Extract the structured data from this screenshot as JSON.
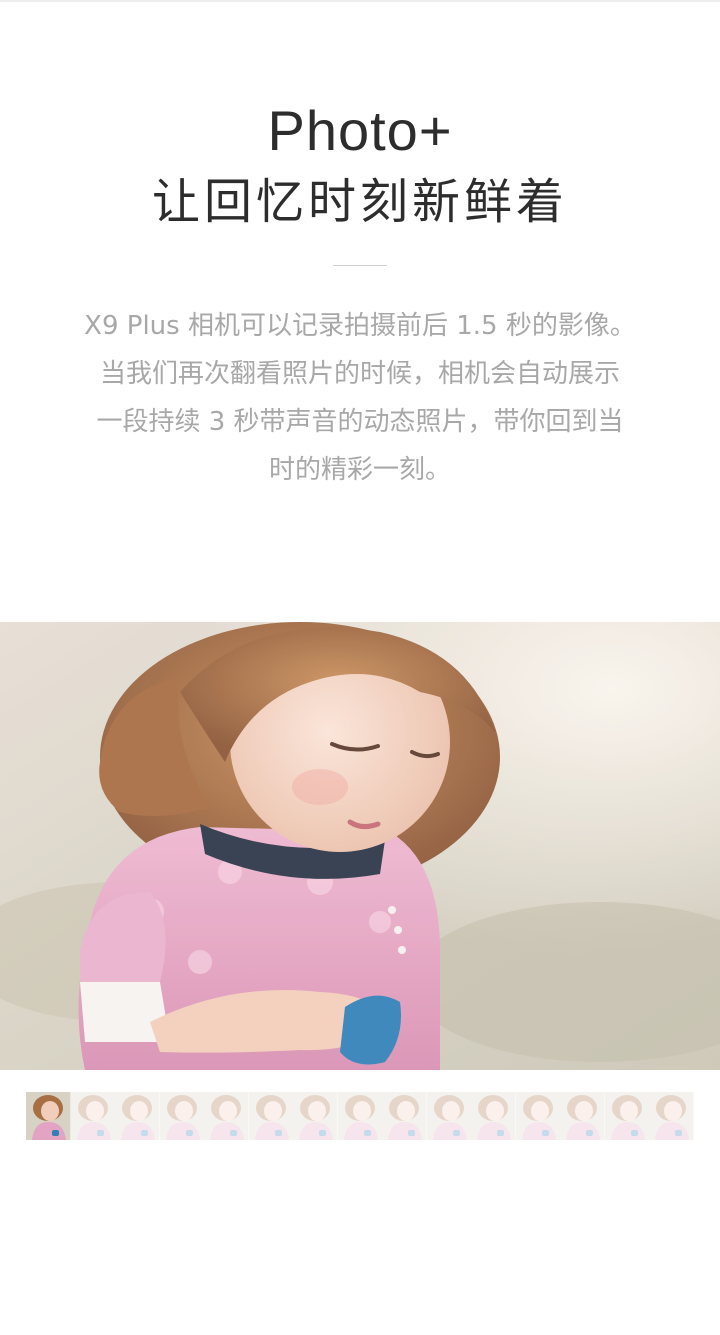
{
  "header": {
    "title_en": "Photo+",
    "title_cn": "让回忆时刻新鲜着"
  },
  "description": {
    "lines": [
      "X9 Plus 相机可以记录拍摄前后 1.5 秒的影像。",
      "当我们再次翻看照片的时候，相机会自动展示",
      "一段持续 3 秒带声音的动态照片，带你回到当",
      "时的精彩一刻。"
    ]
  },
  "hero": {
    "subject": "little-girl-photo",
    "colors": {
      "background": "#d9d3c6",
      "dress": "#e8a8c6",
      "hair": "#b07a4e",
      "skin": "#f4d3c4",
      "toy": "#2f7fb8"
    }
  },
  "filmstrip": {
    "frame_count": 15,
    "active_index": 0
  }
}
